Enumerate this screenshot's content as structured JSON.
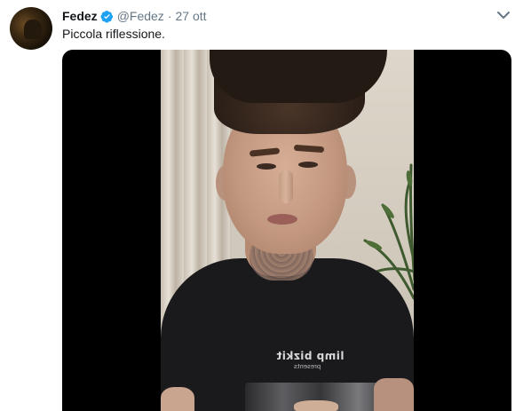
{
  "tweet": {
    "display_name": "Fedez",
    "handle": "@Fedez",
    "separator": "·",
    "time": "27 ott",
    "text": "Piccola riflessione.",
    "verified": true,
    "icons": {
      "verified": "verified-badge-icon",
      "caret": "chevron-down-icon"
    },
    "colors": {
      "verified": "#1da1f2",
      "handle": "#657786",
      "text": "#14171a"
    }
  },
  "video": {
    "shirt_text": "limp bizkit",
    "shirt_subtext": "presents"
  }
}
